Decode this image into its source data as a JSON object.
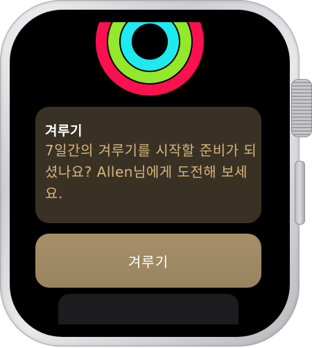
{
  "notification": {
    "app_name": "겨루기",
    "message": "7일간의 겨루기를 시작할 준비가 되셨나요? Allen님에게 도전해 보세요."
  },
  "action": {
    "label": "겨루기"
  },
  "activity_rings": {
    "icon": "activity-rings-icon",
    "colors": {
      "move": "#fa114f",
      "exercise": "#92e82a",
      "stand": "#1eeaef"
    }
  },
  "colors": {
    "accent_text": "#d7b57a",
    "card_background": "#3a3125",
    "button_background": "#a58e68"
  }
}
